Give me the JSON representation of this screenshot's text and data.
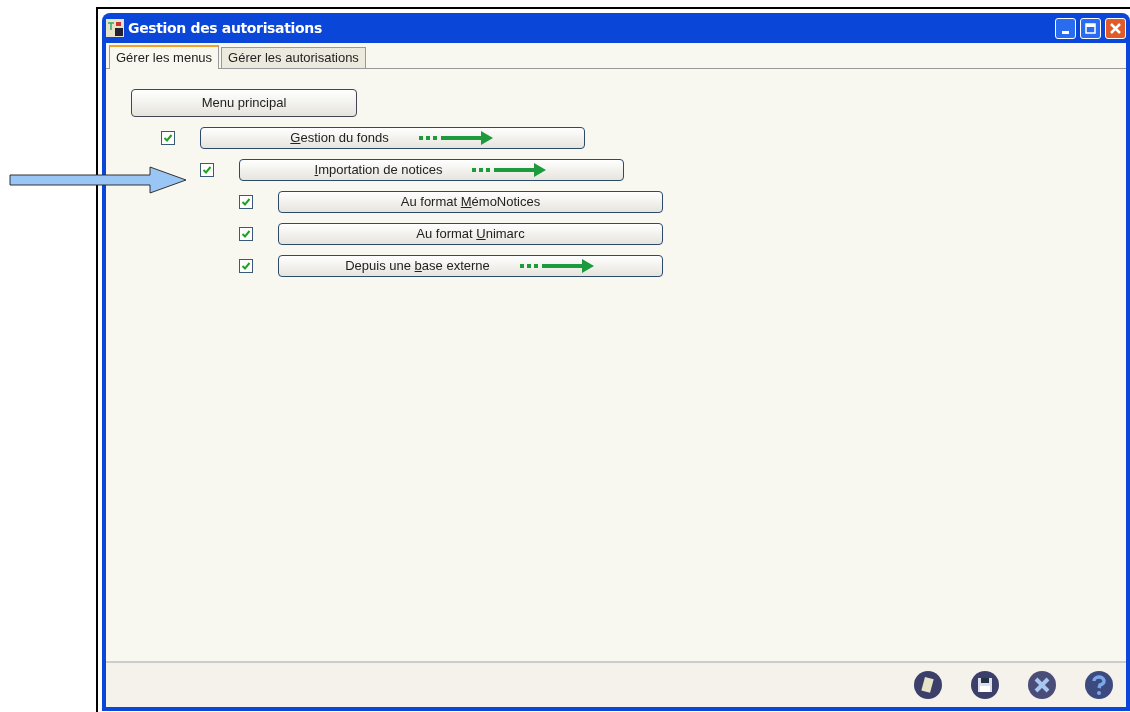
{
  "window": {
    "title": "Gestion des autorisations"
  },
  "tabs": [
    {
      "label": "Gérer les menus",
      "selected": true
    },
    {
      "label": "Gérer les autorisations",
      "selected": false
    }
  ],
  "root": {
    "label": "Menu principal"
  },
  "menu_tree": [
    {
      "label": {
        "mnemonic": "G",
        "after": "estion du fonds"
      },
      "checked": true,
      "has_submenu": true,
      "children": [
        {
          "label": {
            "mnemonic": "I",
            "after": "mportation de notices"
          },
          "checked": true,
          "has_submenu": true,
          "children": [
            {
              "label": {
                "before": "Au format ",
                "mnemonic": "M",
                "after": "émoNotices"
              },
              "checked": true,
              "has_submenu": false
            },
            {
              "label": {
                "before": "Au format ",
                "mnemonic": "U",
                "after": "nimarc"
              },
              "checked": true,
              "has_submenu": false
            },
            {
              "label": {
                "before": "Depuis une ",
                "mnemonic": "b",
                "after": "ase externe"
              },
              "checked": true,
              "has_submenu": true
            }
          ]
        }
      ]
    }
  ]
}
